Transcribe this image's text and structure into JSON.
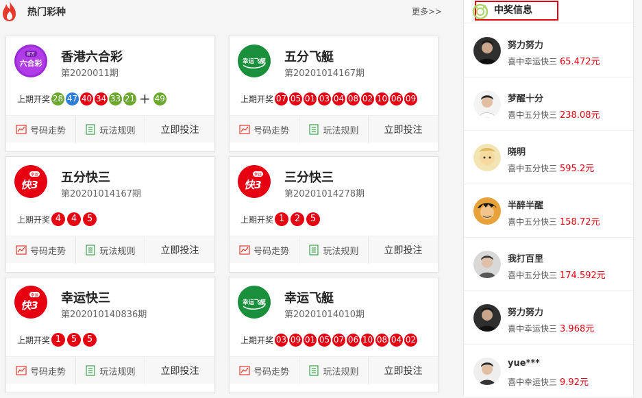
{
  "header": {
    "title": "热门彩种",
    "more": "更多>>"
  },
  "labels": {
    "last_draw": "上期开奖",
    "trend": "号码走势",
    "rules": "玩法规则",
    "bet": "立即投注",
    "plus": "+"
  },
  "cards": [
    {
      "name": "香港六合彩",
      "period": "第2020011期",
      "logo_text": "六合彩",
      "logo_top": "官方",
      "balls": [
        "28",
        "47",
        "40",
        "34",
        "33",
        "21"
      ],
      "special": "49"
    },
    {
      "name": "五分飞艇",
      "period": "第20201014167期",
      "logo_text": "幸运飞艇",
      "balls": [
        "07",
        "05",
        "01",
        "03",
        "04",
        "08",
        "02",
        "10",
        "06",
        "09"
      ]
    },
    {
      "name": "五分快三",
      "period": "第20201014167期",
      "logo_text": "快3",
      "logo_top": "幸运",
      "balls": [
        "4",
        "4",
        "5"
      ]
    },
    {
      "name": "三分快三",
      "period": "第20201014278期",
      "logo_text": "快3",
      "logo_top": "幸运",
      "balls": [
        "1",
        "2",
        "5"
      ]
    },
    {
      "name": "幸运快三",
      "period": "第202010140836期",
      "logo_text": "快3",
      "logo_top": "幸运",
      "balls": [
        "1",
        "5",
        "5"
      ]
    },
    {
      "name": "幸运飞艇",
      "period": "第20201014010期",
      "logo_text": "幸运飞艇",
      "balls": [
        "03",
        "09",
        "01",
        "05",
        "07",
        "06",
        "10",
        "08",
        "04",
        "02"
      ]
    }
  ],
  "sidebar": {
    "title": "中奖信息",
    "winners": [
      {
        "name": "努力努力",
        "game": "喜中幸运快三",
        "amount": "65.472元"
      },
      {
        "name": "梦醒十分",
        "game": "喜中五分快三",
        "amount": "238.08元"
      },
      {
        "name": "晓明",
        "game": "喜中五分快三",
        "amount": "595.2元"
      },
      {
        "name": "半醉半醒",
        "game": "喜中五分快三",
        "amount": "158.72元"
      },
      {
        "name": "我打百里",
        "game": "喜中五分快三",
        "amount": "174.592元"
      },
      {
        "name": "努力努力",
        "game": "喜中幸运快三",
        "amount": "3.968元"
      },
      {
        "name": "yue***",
        "game": "喜中幸运快三",
        "amount": "9.92元"
      }
    ]
  },
  "colors": {
    "accent": "#e60012",
    "green_ball": "#6aa82e",
    "blue_ball": "#2d7fd8",
    "logo_green": "#1a8f3c"
  },
  "icons": [
    "flame-icon",
    "medal-icon",
    "trend-icon",
    "rules-icon"
  ]
}
